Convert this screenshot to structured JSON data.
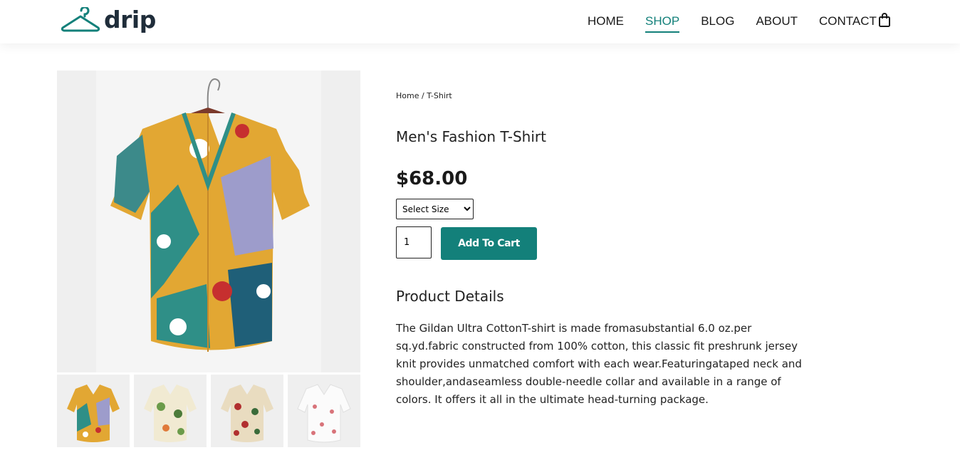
{
  "brand": {
    "logo_text": "drip"
  },
  "nav": {
    "items": [
      {
        "label": "HOME",
        "active": false
      },
      {
        "label": "SHOP",
        "active": true
      },
      {
        "label": "BLOG",
        "active": false
      },
      {
        "label": "ABOUT",
        "active": false
      },
      {
        "label": "CONTACT",
        "active": false
      }
    ],
    "cart_icon": "shopping-bag-icon"
  },
  "breadcrumb": {
    "home": "Home",
    "separator": " / ",
    "current": "T-Shirt"
  },
  "product": {
    "title": "Men's Fashion T-Shirt",
    "price": "$68.00",
    "size_select": {
      "selected": "Select Size",
      "options": [
        "Select Size"
      ]
    },
    "quantity": "1",
    "add_to_cart_label": "Add To Cart",
    "details_heading": "Product Details",
    "description": "The Gildan Ultra CottonT-shirt is made fromasubstantial 6.0 oz.per sq.yd.fabric constructed from 100% cotton, this classic fit preshrunk jersey knit provides unmatched comfort with each wear.Featuringataped neck and shoulder,andaseamless double-needle collar and available in a range of colors. It offers it all in the ultimate head-turning package."
  },
  "gallery": {
    "main_image": "patterned-shirt-image",
    "thumbnails": [
      "shirt-thumb-1",
      "shirt-thumb-2",
      "shirt-thumb-3",
      "shirt-thumb-4"
    ]
  },
  "colors": {
    "accent": "#13807a",
    "text": "#1a1a1a",
    "image_bg": "#efefef"
  }
}
